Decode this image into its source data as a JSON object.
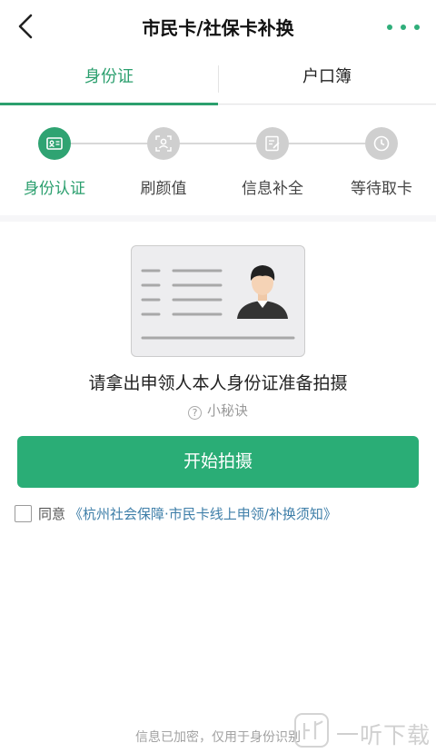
{
  "header": {
    "title": "市民卡/社保卡补换",
    "back_icon": "chevron-left-icon",
    "more_icon": "more-dots-icon",
    "accent": "#2fae7a"
  },
  "tabs": [
    {
      "label": "身份证",
      "active": true
    },
    {
      "label": "户口簿",
      "active": false
    }
  ],
  "steps": [
    {
      "label": "身份认证",
      "icon": "id-card-icon",
      "active": true
    },
    {
      "label": "刷颜值",
      "icon": "face-scan-icon",
      "active": false
    },
    {
      "label": "信息补全",
      "icon": "edit-form-icon",
      "active": false
    },
    {
      "label": "等待取卡",
      "icon": "clock-icon",
      "active": false
    }
  ],
  "main": {
    "illustration": "id-card-illustration",
    "instruction": "请拿出申领人本人身份证准备拍摄",
    "tips_label": "小秘诀",
    "start_button": "开始拍摄"
  },
  "agreement": {
    "checked": false,
    "prefix": "同意",
    "link": "《杭州社会保障·市民卡线上申领/补换须知》"
  },
  "footer": {
    "note": "信息已加密，仅用于身份识别"
  },
  "watermark": {
    "text": "一听下载"
  },
  "colors": {
    "primary": "#2aad76",
    "link": "#3f7fa9",
    "inactive": "#cfcfcf"
  }
}
